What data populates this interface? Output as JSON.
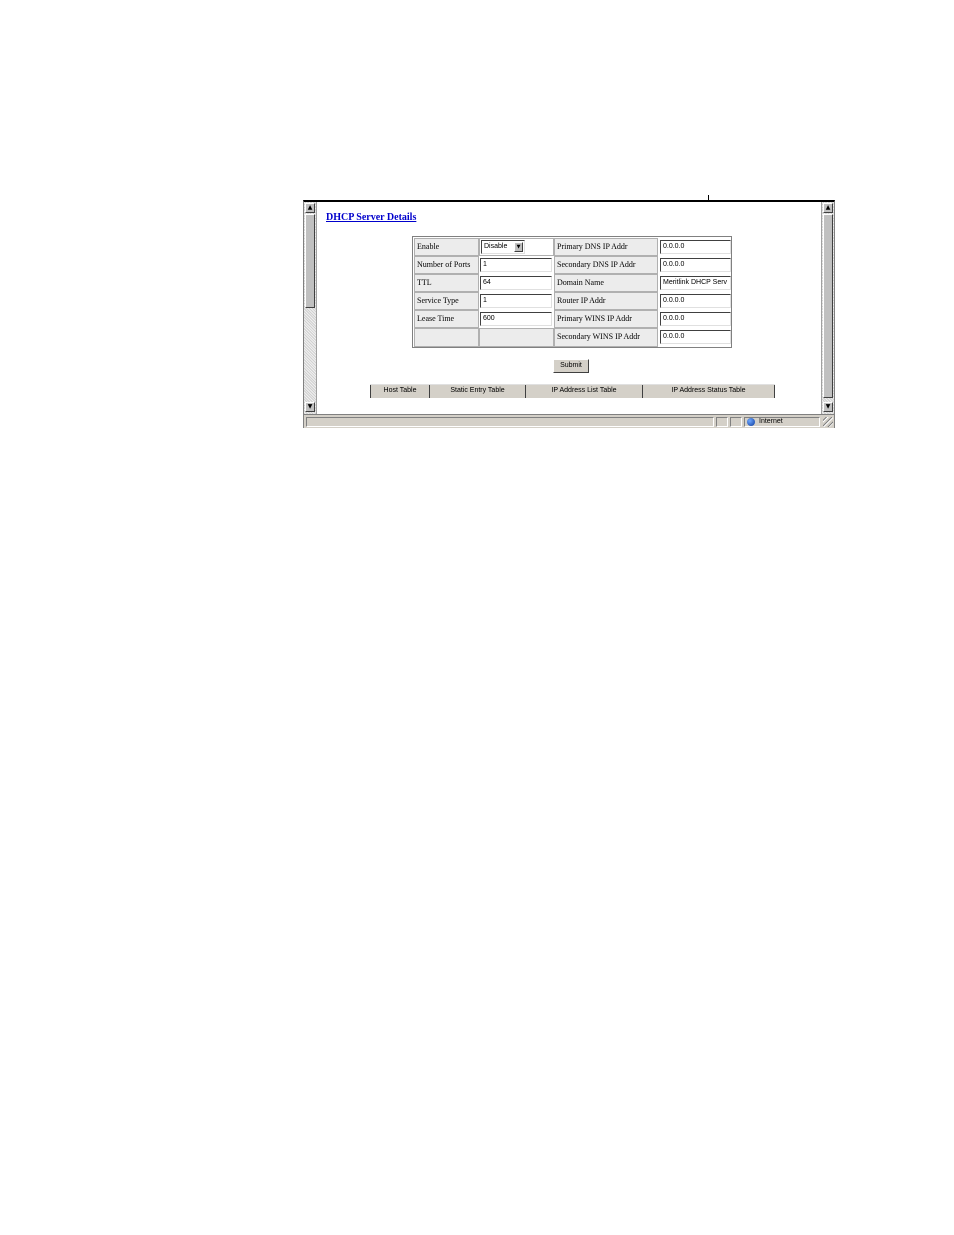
{
  "page": {
    "title": "DHCP Server Details"
  },
  "form": {
    "enable": {
      "label": "Enable",
      "value": "Disable"
    },
    "number_of_ports": {
      "label": "Number of Ports",
      "value": "1"
    },
    "ttl": {
      "label": "TTL",
      "value": "64"
    },
    "service_type": {
      "label": "Service Type",
      "value": "1"
    },
    "lease_time": {
      "label": "Lease Time",
      "value": "600"
    },
    "primary_dns": {
      "label": "Primary DNS IP Addr",
      "value": "0.0.0.0"
    },
    "secondary_dns": {
      "label": "Secondary DNS IP Addr",
      "value": "0.0.0.0"
    },
    "domain_name": {
      "label": "Domain Name",
      "value": "Meritlink DHCP Serv"
    },
    "router_ip": {
      "label": "Router IP Addr",
      "value": "0.0.0.0"
    },
    "primary_wins": {
      "label": "Primary WINS IP Addr",
      "value": "0.0.0.0"
    },
    "secondary_wins": {
      "label": "Secondary WINS IP Addr",
      "value": "0.0.0.0"
    }
  },
  "actions": {
    "submit_label": "Submit"
  },
  "nav": {
    "host_table": "Host Table",
    "static_entry_table": "Static Entry Table",
    "ip_address_list_table": "IP Address List Table",
    "ip_address_status_table": "IP Address Status Table"
  },
  "status_bar": {
    "zone": "Internet"
  },
  "icons": {
    "scroll_up": "scroll-up-arrow",
    "scroll_down": "scroll-down-arrow",
    "dropdown": "chevron-down",
    "zone": "globe",
    "resize": "resize-grip"
  },
  "colors": {
    "link": "#0000cc",
    "chrome": "#d4d0c8",
    "label_cell": "#ececec"
  }
}
